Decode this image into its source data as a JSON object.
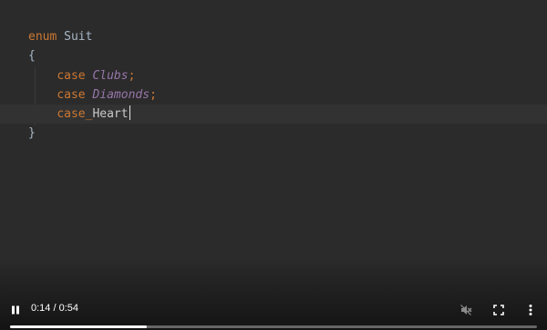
{
  "editor": {
    "lines": [
      {
        "tokens": [
          {
            "cls": "tok-kw",
            "text": "enum"
          },
          {
            "cls": "tok-plain",
            "text": " "
          },
          {
            "cls": "tok-type",
            "text": "Suit"
          }
        ]
      },
      {
        "tokens": [
          {
            "cls": "tok-brace",
            "text": "{"
          }
        ]
      },
      {
        "tokens": [
          {
            "cls": "tok-plain",
            "text": "    "
          },
          {
            "cls": "tok-kw",
            "text": "case"
          },
          {
            "cls": "tok-plain",
            "text": " "
          },
          {
            "cls": "tok-member",
            "text": "Clubs"
          },
          {
            "cls": "tok-punct",
            "text": ";"
          }
        ]
      },
      {
        "tokens": [
          {
            "cls": "tok-plain",
            "text": "    "
          },
          {
            "cls": "tok-kw",
            "text": "case"
          },
          {
            "cls": "tok-plain",
            "text": " "
          },
          {
            "cls": "tok-member",
            "text": "Diamonds"
          },
          {
            "cls": "tok-punct",
            "text": ";"
          }
        ]
      },
      {
        "tokens": [
          {
            "cls": "tok-plain",
            "text": "    "
          },
          {
            "cls": "tok-kw",
            "text": "case"
          },
          {
            "cls": "squiggle",
            "text": "_"
          },
          {
            "cls": "tok-plain",
            "text": "Heart"
          }
        ],
        "current": true,
        "caret": true
      },
      {
        "tokens": [
          {
            "cls": "tok-brace",
            "text": "}"
          }
        ]
      }
    ]
  },
  "player": {
    "play_pause_icon": "pause-icon",
    "current_time": "0:14",
    "separator": " / ",
    "duration": "0:54",
    "progress_fraction": 0.26,
    "mute_icon": "volume-muted-icon",
    "fullscreen_icon": "fullscreen-icon",
    "more_icon": "more-vertical-icon"
  },
  "colors": {
    "background": "#2b2b2b",
    "keyword": "#cc7832",
    "member": "#9876aa",
    "text": "#c9c9c9",
    "progress": "#ffffff"
  }
}
